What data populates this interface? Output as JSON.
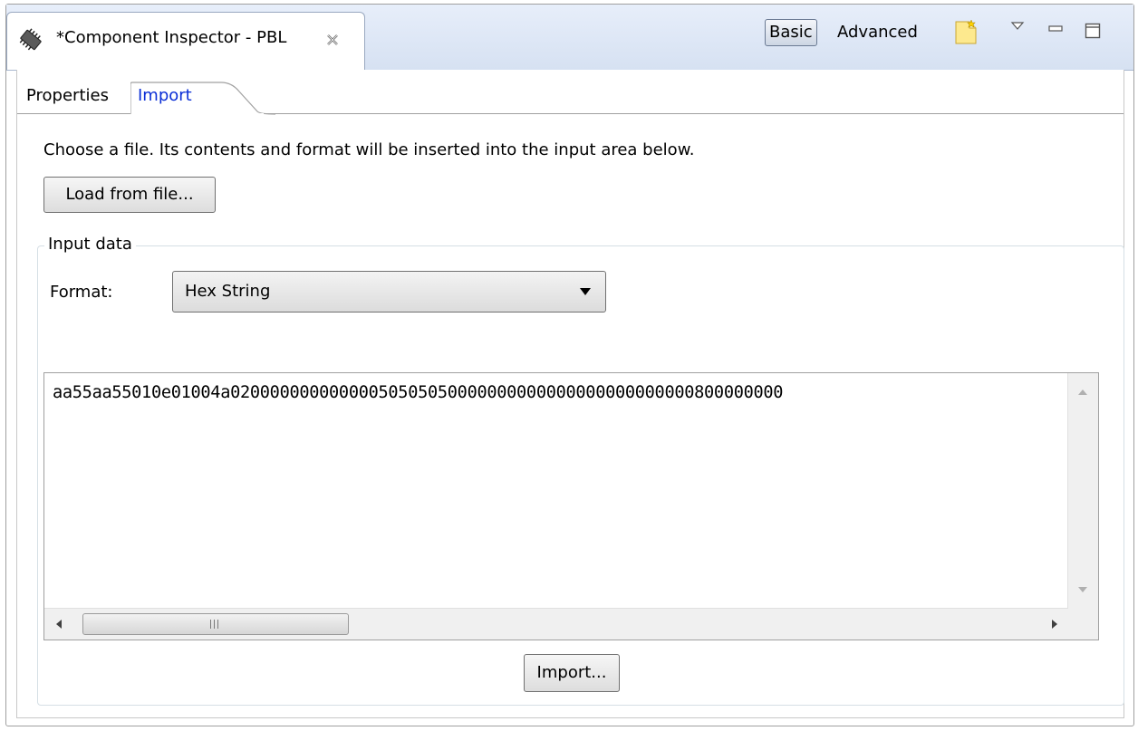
{
  "view": {
    "title": "*Component Inspector - PBL",
    "icon": "chip-icon",
    "close_icon": "close-icon"
  },
  "toolbar": {
    "basic_label": "Basic",
    "advanced_label": "Advanced",
    "new_icon": "new-document-icon",
    "menu_icon": "view-menu-icon",
    "minimize_icon": "minimize-icon",
    "maximize_icon": "maximize-icon"
  },
  "tabs": [
    {
      "label": "Properties",
      "active": false
    },
    {
      "label": "Import",
      "active": true
    }
  ],
  "import_page": {
    "instructions": "Choose a file. Its contents and format will be inserted into the input area below.",
    "load_button": "Load from file...",
    "group_label": "Input data",
    "format_label": "Format:",
    "format_value": "Hex String",
    "input_text": "aa55aa55010e01004a02000000000000050505050000000000000000000000000800000000",
    "import_button": "Import..."
  },
  "colors": {
    "titlebar": "#dde6f4",
    "active_tab_text": "#0a2ed6",
    "border": "#a0a0a0"
  }
}
